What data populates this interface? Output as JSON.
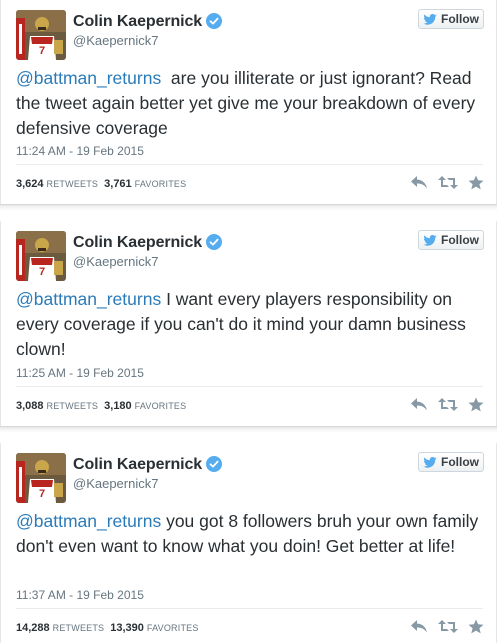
{
  "colors": {
    "mention": "#2b7bb9",
    "verified": "#55acee",
    "twitter_bird": "#55acee",
    "action_icon": "#8899a6"
  },
  "tweets": [
    {
      "author_name": "Colin Kaepernick",
      "handle": "@Kaepernick7",
      "follow_label": "Follow",
      "mention": "@battman_returns",
      "text": "  are you illiterate or just ignorant? Read the tweet again better yet give me your breakdown of every defensive coverage",
      "timestamp": "11:24 AM - 19 Feb 2015",
      "retweets": "3,624",
      "retweets_label": "RETWEETS",
      "favorites": "3,761",
      "favorites_label": "FAVORITES"
    },
    {
      "author_name": "Colin Kaepernick",
      "handle": "@Kaepernick7",
      "follow_label": "Follow",
      "mention": "@battman_returns",
      "text": " I want every players responsibility on every coverage if you can't do it mind your damn business clown!",
      "timestamp": "11:25 AM - 19 Feb 2015",
      "retweets": "3,088",
      "retweets_label": "RETWEETS",
      "favorites": "3,180",
      "favorites_label": "FAVORITES"
    },
    {
      "author_name": "Colin Kaepernick",
      "handle": "@Kaepernick7",
      "follow_label": "Follow",
      "mention": "@battman_returns",
      "text": " you got 8 followers bruh your own family don't even want to know what you doin! Get better at life!",
      "timestamp": "11:37 AM - 19 Feb 2015",
      "retweets": "14,288",
      "retweets_label": "RETWEETS",
      "favorites": "13,390",
      "favorites_label": "FAVORITES"
    }
  ]
}
